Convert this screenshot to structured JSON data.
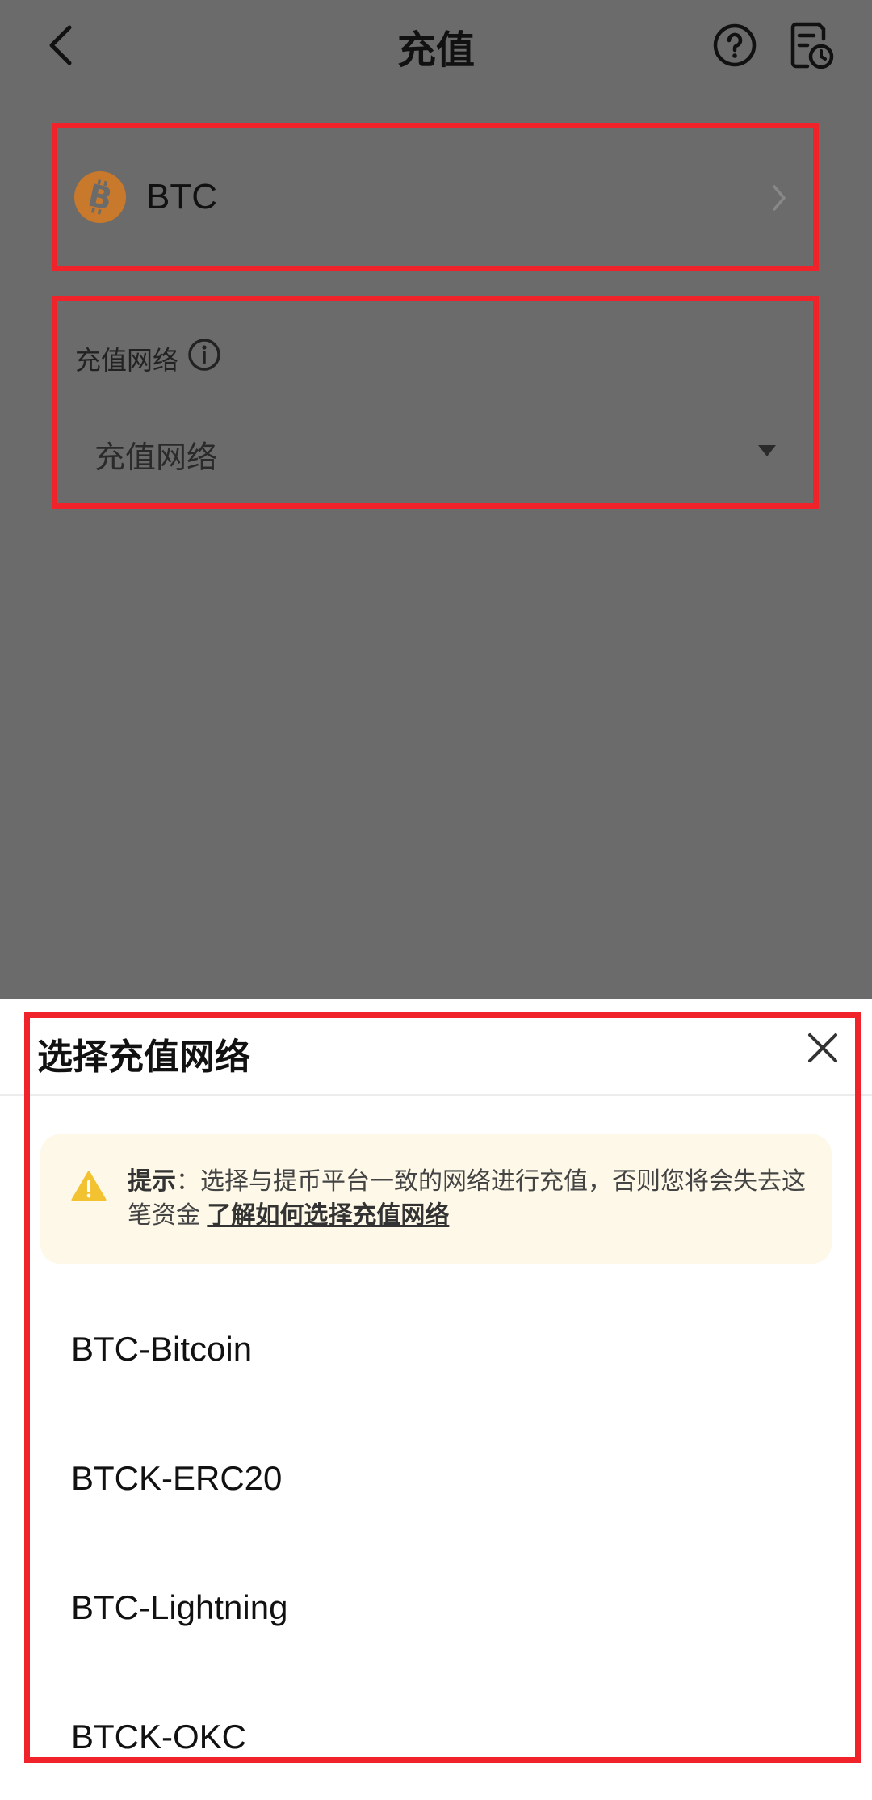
{
  "header": {
    "title": "充值",
    "back_icon": "chevron-left-icon",
    "help_icon": "question-circle-icon",
    "history_icon": "document-clock-icon"
  },
  "coin": {
    "name": "BTC",
    "icon": "bitcoin-icon",
    "color": "#c9792b"
  },
  "network_field": {
    "label": "充值网络",
    "placeholder": "充值网络"
  },
  "sheet": {
    "title": "选择充值网络",
    "notice": {
      "prefix": "提示",
      "colon": "：",
      "text": "选择与提币平台一致的网络进行充值，否则您将会失去这笔资金",
      "link": "了解如何选择充值网络"
    },
    "networks": [
      "BTC-Bitcoin",
      "BTCK-ERC20",
      "BTC-Lightning",
      "BTCK-OKC"
    ]
  },
  "colors": {
    "overlay": "#6b6b6b",
    "highlight": "#f0222a",
    "notice_bg": "#fdf8e7",
    "warning": "#f2c230"
  }
}
